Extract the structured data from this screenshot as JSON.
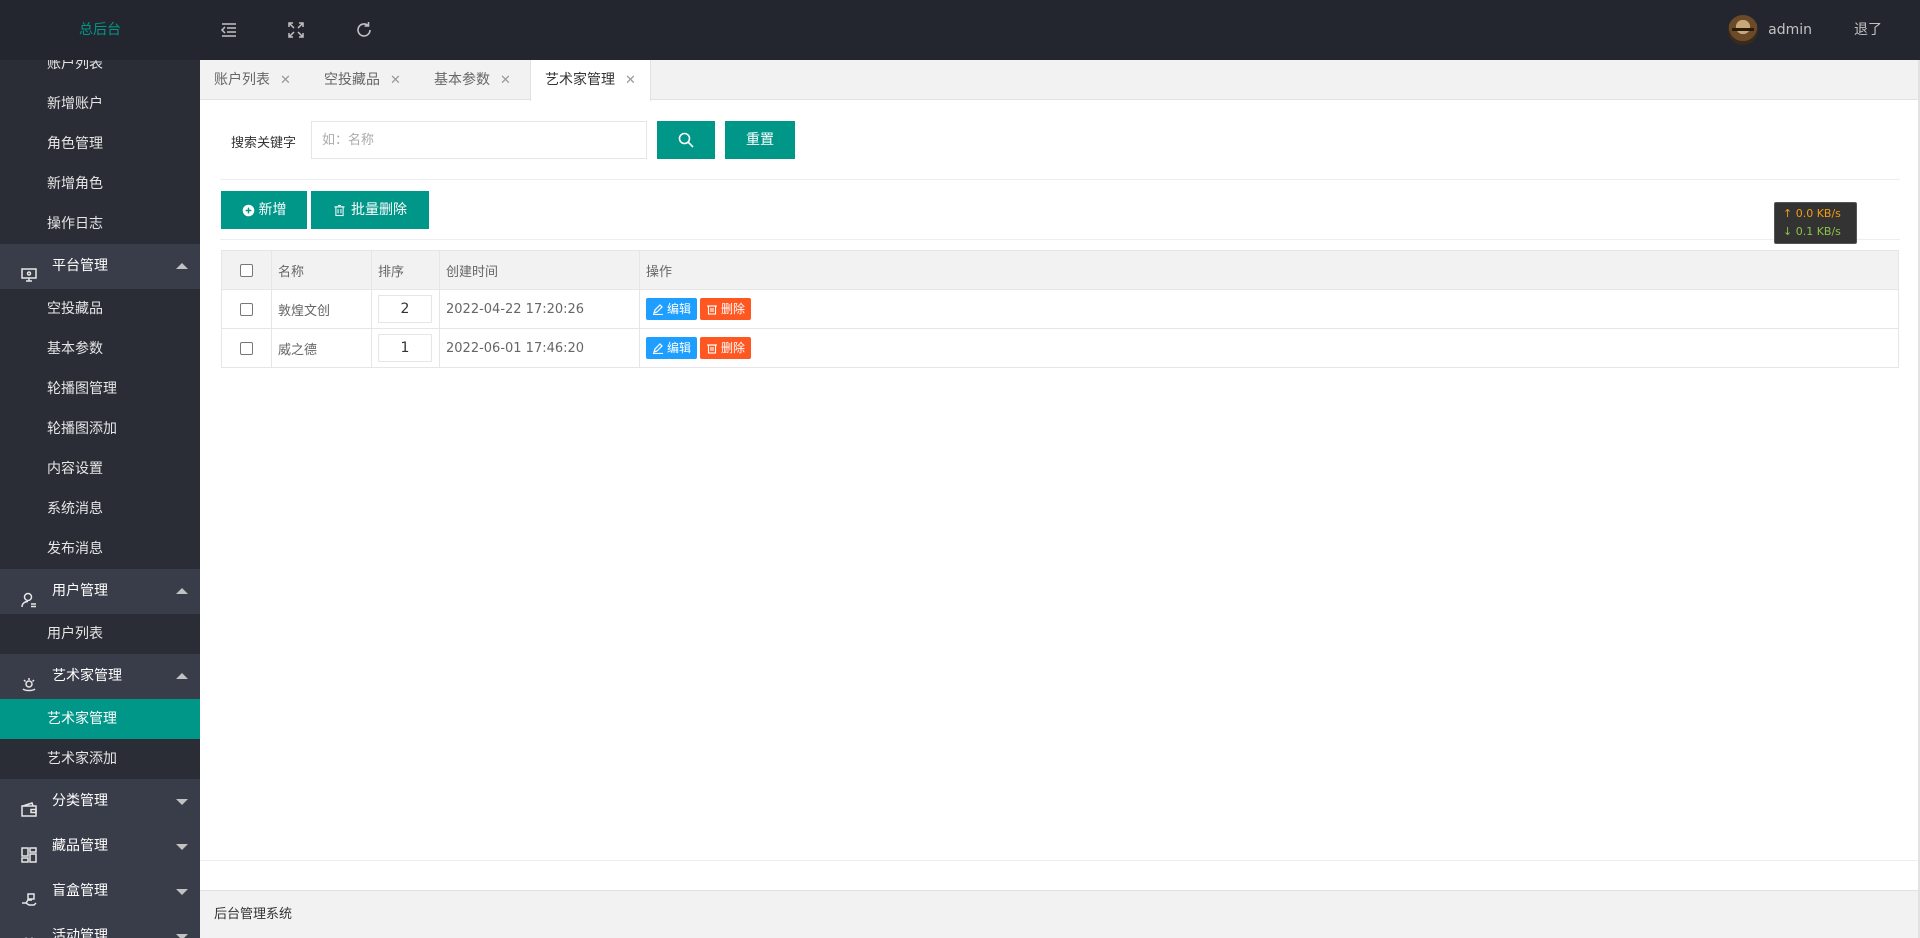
{
  "header": {
    "logo": "总后台",
    "username": "admin",
    "logout": "退了"
  },
  "sidebar": {
    "items_top": [
      "账户列表",
      "新增账户",
      "角色管理",
      "新增角色",
      "操作日志"
    ],
    "groups": [
      {
        "label": "平台管理",
        "icon": "monitor-icon",
        "expanded": true,
        "children": [
          "空投藏品",
          "基本参数",
          "轮播图管理",
          "轮播图添加",
          "内容设置",
          "系统消息",
          "发布消息"
        ]
      },
      {
        "label": "用户管理",
        "icon": "user-icon",
        "expanded": true,
        "children": [
          "用户列表"
        ]
      },
      {
        "label": "艺术家管理",
        "icon": "artist-icon",
        "expanded": true,
        "children": [
          "艺术家管理",
          "艺术家添加"
        ],
        "active_child": 0
      },
      {
        "label": "分类管理",
        "icon": "wallet-icon",
        "expanded": false
      },
      {
        "label": "藏品管理",
        "icon": "grid-icon",
        "expanded": false
      },
      {
        "label": "盲盒管理",
        "icon": "hand-icon",
        "expanded": false
      },
      {
        "label": "活动管理",
        "icon": "calendar-icon",
        "expanded": false
      }
    ]
  },
  "tabs": [
    {
      "label": "账户列表",
      "active": false
    },
    {
      "label": "空投藏品",
      "active": false
    },
    {
      "label": "基本参数",
      "active": false
    },
    {
      "label": "艺术家管理",
      "active": true
    }
  ],
  "search": {
    "label": "搜索关键字",
    "placeholder": "如：名称",
    "value": "",
    "reset_label": "重置"
  },
  "actions": {
    "add_label": "新增",
    "batch_delete_label": "批量删除"
  },
  "net_speed": {
    "up": "↑ 0.0 KB/s",
    "down": "↓ 0.1 KB/s"
  },
  "table": {
    "columns": [
      "名称",
      "排序",
      "创建时间",
      "操作"
    ],
    "rows": [
      {
        "name": "敦煌文创",
        "sort": "2",
        "created": "2022-04-22 17:20:26"
      },
      {
        "name": "威之德",
        "sort": "1",
        "created": "2022-06-01 17:46:20"
      }
    ],
    "edit_label": "编辑",
    "delete_label": "删除"
  },
  "footer": {
    "text": "后台管理系统"
  }
}
